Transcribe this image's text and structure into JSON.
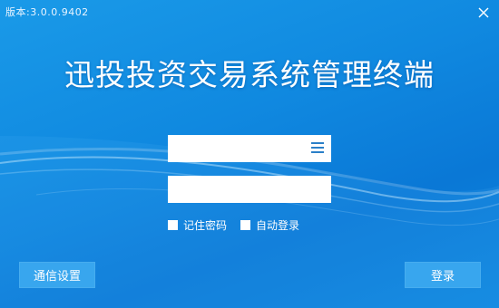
{
  "window": {
    "version": "版本:3.0.0.9402",
    "title": "迅投投资交易系统管理终端"
  },
  "form": {
    "account_value": "",
    "password_value": "",
    "remember_password_label": "记住密码",
    "remember_password_checked": false,
    "auto_login_label": "自动登录",
    "auto_login_checked": false
  },
  "buttons": {
    "settings_label": "通信设置",
    "login_label": "登录"
  },
  "icons": {
    "close": "close-icon",
    "account_menu": "menu-icon"
  },
  "colors": {
    "background": "#1089e0",
    "button": "#38a6ee",
    "text": "#ffffff"
  }
}
